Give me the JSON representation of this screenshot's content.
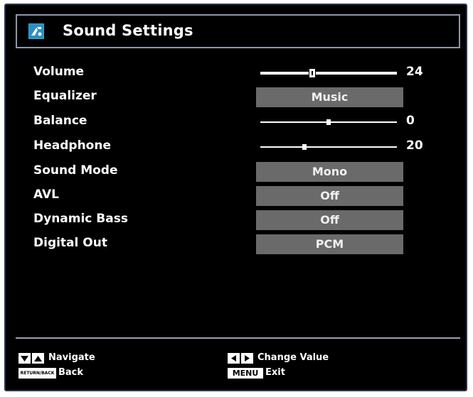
{
  "header": {
    "title": "Sound Settings",
    "icon": "tv-settings-icon"
  },
  "settings": [
    {
      "label": "Volume",
      "type": "slider",
      "value": "24",
      "level": 0.37
    },
    {
      "label": "Equalizer",
      "type": "option",
      "value": "Music"
    },
    {
      "label": "Balance",
      "type": "slider",
      "value": "0",
      "level": 0.5
    },
    {
      "label": "Headphone",
      "type": "slider",
      "value": "20",
      "level": 0.31
    },
    {
      "label": "Sound Mode",
      "type": "option",
      "value": "Mono"
    },
    {
      "label": "AVL",
      "type": "option",
      "value": "Off"
    },
    {
      "label": "Dynamic Bass",
      "type": "option",
      "value": "Off"
    },
    {
      "label": "Digital Out",
      "type": "option",
      "value": "PCM"
    }
  ],
  "footer": {
    "navigate_label": "Navigate",
    "back_key": "RETURN/BACK",
    "back_label": "Back",
    "change_value_label": "Change Value",
    "menu_key": "MENU",
    "exit_label": "Exit"
  },
  "colors": {
    "background": "#000000",
    "option_box": "#6a6a6a",
    "text": "#ffffff",
    "frame": "#8f97a8"
  }
}
